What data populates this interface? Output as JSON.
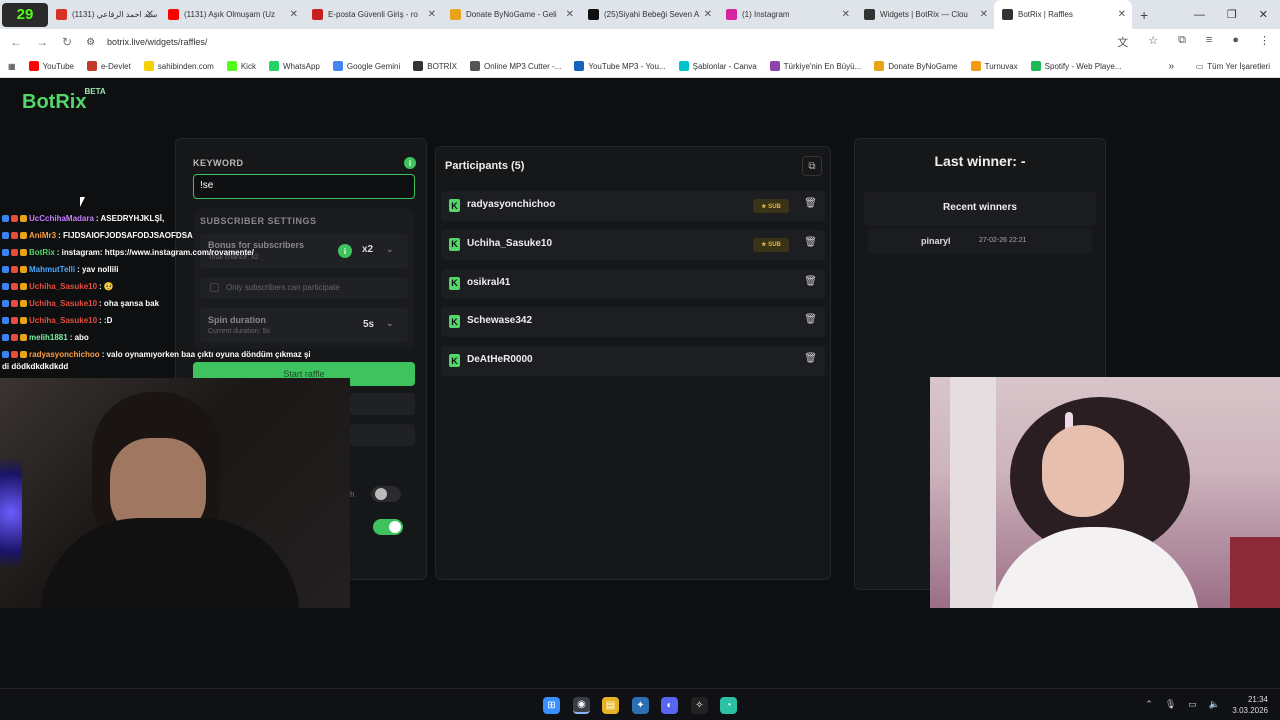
{
  "browser": {
    "kick_badge": "29",
    "tabs": [
      {
        "title": "(1131) سيد احمد الرفاعي",
        "icon_color": "#d93025",
        "active": false
      },
      {
        "title": "(1131) Aşık Olmuşam (Uz",
        "icon_color": "#ff0000",
        "active": false
      },
      {
        "title": "E-posta Güvenli Giriş - ro",
        "icon_color": "#c5221f",
        "active": false
      },
      {
        "title": "Donate ByNoGame - Geli",
        "icon_color": "#e8a317",
        "active": false
      },
      {
        "title": "(25)Siyahi Bebeği Seven A",
        "icon_color": "#111111",
        "active": false
      },
      {
        "title": "(1) Instagram",
        "icon_color": "#d6249f",
        "active": false
      },
      {
        "title": "Widgets | BotRix — Clou",
        "icon_color": "#333333",
        "active": false
      },
      {
        "title": "BotRix | Raffles",
        "icon_color": "#333333",
        "active": true
      }
    ],
    "new_tab": "+",
    "window_controls": {
      "minimize": "—",
      "maximize": "❐",
      "close": "✕"
    },
    "url": "botrix.live/widgets/raffles/",
    "bookmarks": [
      {
        "label": "YouTube",
        "color": "#ff0000"
      },
      {
        "label": "e-Devlet",
        "color": "#c0392b"
      },
      {
        "label": "sahibinden.com",
        "color": "#f5d000"
      },
      {
        "label": "Kick",
        "color": "#53fc18"
      },
      {
        "label": "WhatsApp",
        "color": "#25d366"
      },
      {
        "label": "Google Gemini",
        "color": "#4285f4"
      },
      {
        "label": "BOTRİX",
        "color": "#333333"
      },
      {
        "label": "Online MP3 Cutter -...",
        "color": "#555555"
      },
      {
        "label": "YouTube MP3 - You...",
        "color": "#1565c0"
      },
      {
        "label": "Şablonlar - Canva",
        "color": "#00c4cc"
      },
      {
        "label": "Türkiye'nin En Büyü...",
        "color": "#8e44ad"
      },
      {
        "label": "Donate ByNoGame",
        "color": "#e8a317"
      },
      {
        "label": "Turnuvax",
        "color": "#f39c12"
      },
      {
        "label": "Spotify - Web Playe...",
        "color": "#1db954"
      }
    ],
    "all_bookmarks": "Tüm Yer İşaretleri"
  },
  "app": {
    "logo": "BotRix",
    "logo_badge": "BETA"
  },
  "settings": {
    "keyword_label": "KEYWORD",
    "keyword_value": "!se",
    "subscriber_settings_label": "SUBSCRIBER SETTINGS",
    "bonus_label": "Bonus for subscribers",
    "bonus_hint": "Total chance: x2",
    "bonus_value": "x2",
    "only_subs_label": "Only subscribers can participate",
    "spin_label": "Spin duration",
    "spin_hint": "Current duration: 5s",
    "spin_value": "5s",
    "start_button": "Start raffle",
    "partial_label": "h"
  },
  "participants": {
    "title": "Participants (5)",
    "sub_badge": "★ SUB",
    "list": [
      {
        "name": "radyasyonchichoo",
        "sub": true
      },
      {
        "name": "Uchiha_Sasuke10",
        "sub": true
      },
      {
        "name": "osikral41",
        "sub": false
      },
      {
        "name": "Schewase342",
        "sub": false
      },
      {
        "name": "DeAtHeR0000",
        "sub": false
      }
    ]
  },
  "winners": {
    "last_winner": "Last winner: -",
    "recent_title": "Recent winners",
    "recent": [
      {
        "name": "pinaryl",
        "date": "27-02-26 22:21"
      }
    ]
  },
  "chat": [
    {
      "user": "UcCchihaMadara",
      "color": "#c77dff",
      "text": " : ASEDRYHJKLŞİ,"
    },
    {
      "user": "AniMr3",
      "color": "#ff9f43",
      "text": " : FIJDSAIOFJODSAFODJSAOFDSA"
    },
    {
      "user": "BotRix",
      "color": "#53d769",
      "text": " : instagram: https://www.instagram.com/rovamente/"
    },
    {
      "user": "MahmutTelli",
      "color": "#4aa8ff",
      "text": " : yav nollili"
    },
    {
      "user": "Uchiha_Sasuke10",
      "color": "#e74c3c",
      "text": " : 🥺"
    },
    {
      "user": "Uchiha_Sasuke10",
      "color": "#e74c3c",
      "text": " : oha şansa bak"
    },
    {
      "user": "Uchiha_Sasuke10",
      "color": "#e74c3c",
      "text": " : :D"
    },
    {
      "user": "melih1881",
      "color": "#7bed9f",
      "text": " : abo"
    },
    {
      "user": "radyasyonchichoo",
      "color": "#ff9f43",
      "text": " : valo oynamıyorken baa çıktı oyuna döndüm çıkmaz şi"
    }
  ],
  "chat_continuation": "di dödkdkdkdkdd",
  "taskbar": {
    "time": "21:34",
    "date": "3.03.2026"
  }
}
